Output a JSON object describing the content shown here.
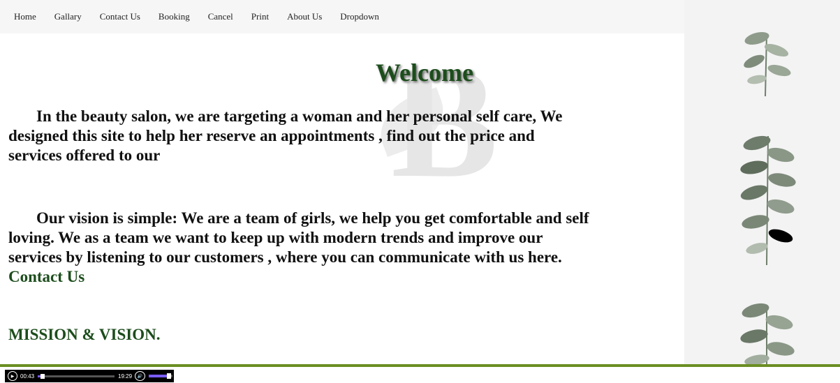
{
  "nav": {
    "items": [
      "Home",
      "Gallary",
      "Contact Us",
      "Booking",
      "Cancel",
      "Print",
      "About Us",
      "Dropdown"
    ]
  },
  "welcome": "Welcome",
  "watermark": "B",
  "paragraph1": "In the beauty salon, we are targeting a woman and her personal self care, We designed this site to help her reserve an appointments , find out the price and services offered to our",
  "paragraph2": "Our vision is simple: We are a team of girls, we help you get comfortable and self loving. We as a team we want to keep up with modern trends and improve our services by listening to our customers , where you can communicate with us here.",
  "contact_link": "Contact Us",
  "mission": "MISSION & VISION.",
  "audio": {
    "current_time": "00:43",
    "duration": "19:29",
    "progress": 0.04,
    "volume": 0.85
  },
  "colors": {
    "accent_green": "#1c4d1c",
    "divider_green": "#6b8e23",
    "player_accent": "#7a5cff"
  },
  "icons": [
    "play-icon",
    "volume-icon",
    "eucalyptus-branch"
  ]
}
